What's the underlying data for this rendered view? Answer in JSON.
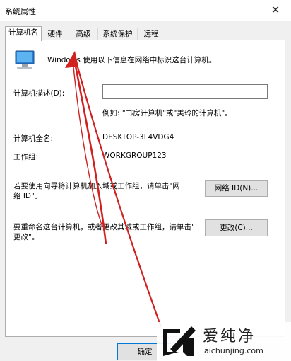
{
  "window": {
    "title": "系统属性",
    "close_glyph": "✕"
  },
  "tabs": [
    "计算机名",
    "硬件",
    "高级",
    "系统保护",
    "远程"
  ],
  "active_tab": "计算机名",
  "intro": "Windows 使用以下信息在网络中标识这台计算机。",
  "description": {
    "label": "计算机描述(D):",
    "value": "",
    "example": "例如: \"书房计算机\"或\"美玲的计算机\"。"
  },
  "full_name": {
    "label": "计算机全名:",
    "value": "DESKTOP-3L4VDG4"
  },
  "workgroup": {
    "label": "工作组:",
    "value": "WORKGROUP123"
  },
  "network_id": {
    "text_line1": "若要使用向导将计算机加入域或工作组，请单击\"网",
    "text_line2": "络 ID\"。",
    "button": "网络 ID(N)..."
  },
  "rename": {
    "text_line1": "要重命名这台计算机，或者更改其域或工作组，请单击\"",
    "text_line2": "更改\"。",
    "button": "更改(C)..."
  },
  "footer": {
    "ok_button": "确定"
  },
  "watermark": {
    "brand": "爱纯净",
    "url": "aichunjing.com"
  },
  "colors": {
    "arrow": "#d02020",
    "ok_border": "#0078d7"
  },
  "icons": [
    "computer-icon",
    "close-icon",
    "watermark-logo-icon"
  ]
}
